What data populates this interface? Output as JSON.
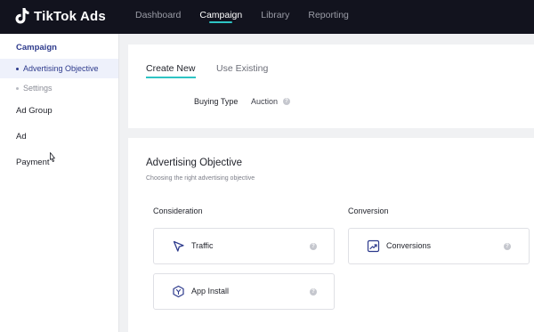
{
  "app": {
    "logo_text": "TikTok Ads"
  },
  "nav": [
    {
      "label": "Dashboard"
    },
    {
      "label": "Campaign"
    },
    {
      "label": "Library"
    },
    {
      "label": "Reporting"
    }
  ],
  "sidebar": {
    "campaign": "Campaign",
    "subitems": [
      {
        "label": "Advertising Objective"
      },
      {
        "label": "Settings"
      }
    ],
    "items": [
      {
        "label": "Ad Group"
      },
      {
        "label": "Ad"
      },
      {
        "label": "Payment"
      }
    ]
  },
  "tabs": [
    {
      "label": "Create New"
    },
    {
      "label": "Use Existing"
    }
  ],
  "buying": {
    "label": "Buying Type",
    "value": "Auction"
  },
  "objective": {
    "title": "Advertising Objective",
    "subtitle": "Choosing the right advertising objective",
    "consideration_label": "Consideration",
    "conversion_label": "Conversion",
    "options": {
      "traffic": "Traffic",
      "app_install": "App Install",
      "conversions": "Conversions"
    }
  },
  "colors": {
    "accent": "#2ec4c4",
    "brand": "#2d3a8c",
    "topbar": "#12131e"
  },
  "icons": [
    "tiktok-logo-icon",
    "help-icon",
    "cursor-arrow-icon",
    "app-install-icon",
    "conversions-icon",
    "mouse-pointer-icon"
  ]
}
